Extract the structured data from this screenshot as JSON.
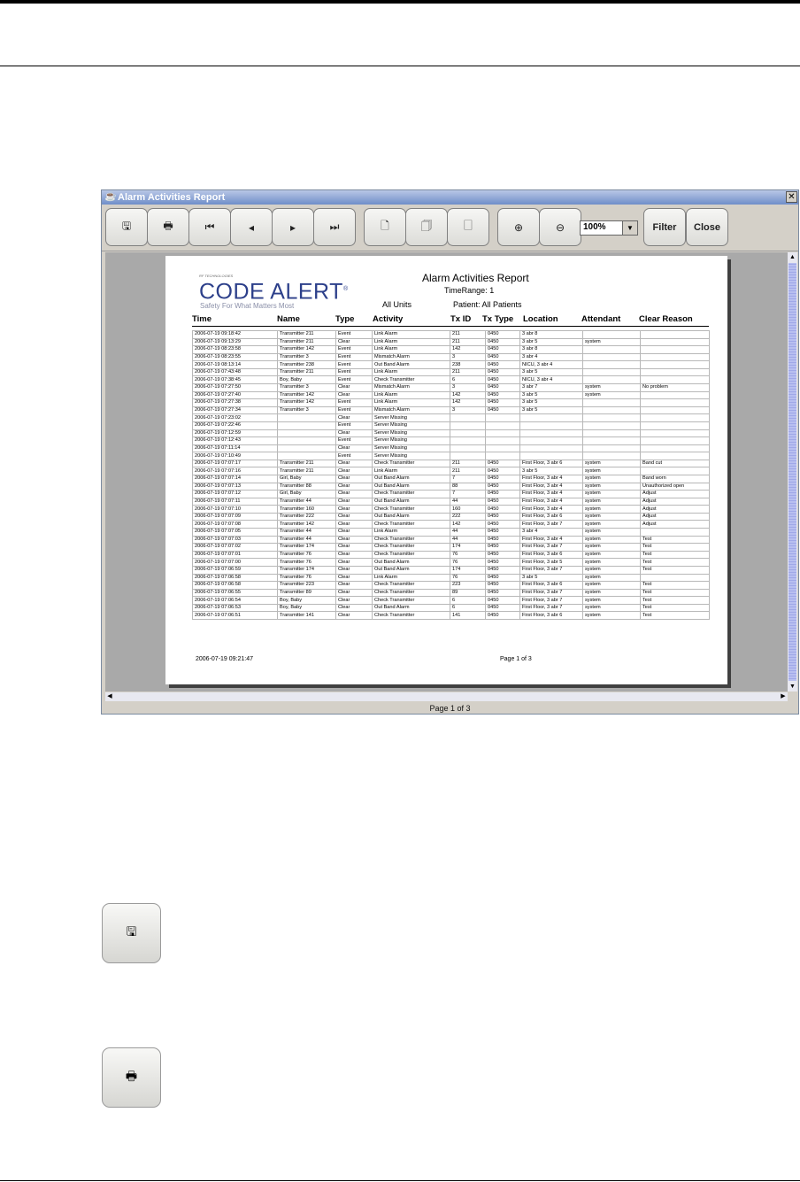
{
  "window": {
    "title": "Alarm Activities Report",
    "close_glyph": "✕"
  },
  "toolbar": {
    "buttons": [
      {
        "icon": "save-icon",
        "glyph": "🖫"
      },
      {
        "icon": "print-icon",
        "glyph": "🖶"
      },
      {
        "icon": "first-page-icon",
        "glyph": "⏮"
      },
      {
        "icon": "previous-page-icon",
        "glyph": "◂"
      },
      {
        "icon": "next-page-icon",
        "glyph": "▸"
      },
      {
        "icon": "last-page-icon",
        "glyph": "⏭"
      },
      {
        "icon": "page-icon",
        "glyph": "🗋"
      },
      {
        "icon": "page-width-icon",
        "glyph": "🗍"
      },
      {
        "icon": "whole-page-icon",
        "glyph": "🗌"
      },
      {
        "icon": "zoom-in-icon",
        "glyph": "⊕"
      },
      {
        "icon": "zoom-out-icon",
        "glyph": "⊖"
      }
    ],
    "zoom_value": "100%",
    "filter_label": "Filter",
    "close_label": "Close"
  },
  "report": {
    "logo_small": "RF TECHNOLOGIES",
    "logo": "CODE ALERT",
    "logo_mark": "®",
    "tagline": "Safety For What Matters Most",
    "title": "Alarm Activities Report",
    "time_range": "TimeRange: 1",
    "units": "All Units",
    "patient": "Patient: All Patients",
    "columns": [
      "Time",
      "Name",
      "Type",
      "Activity",
      "Tx ID",
      "Tx Type",
      "Location",
      "Attendant",
      "Clear Reason"
    ],
    "rows": [
      [
        "2006-07-19 09:18:42",
        "Transmitter 211",
        "Event",
        "Link Alarm",
        "211",
        "0450",
        "3 abr 8",
        "",
        ""
      ],
      [
        "2006-07-19 09:13:29",
        "Transmitter 211",
        "Clear",
        "Link Alarm",
        "211",
        "0450",
        "3 abr 5",
        "system",
        ""
      ],
      [
        "2006-07-19 08:23:58",
        "Transmitter 142",
        "Event",
        "Link Alarm",
        "142",
        "0450",
        "3 abr 8",
        "",
        ""
      ],
      [
        "2006-07-19 08:23:55",
        "Transmitter 3",
        "Event",
        "Mismatch Alarm",
        "3",
        "0450",
        "3 abr 4",
        "",
        ""
      ],
      [
        "2006-07-19 08:13:14",
        "Transmitter 238",
        "Event",
        "Out Band Alarm",
        "238",
        "0450",
        "NICU, 3 abr 4",
        "",
        ""
      ],
      [
        "2006-07-19 07:43:48",
        "Transmitter 211",
        "Event",
        "Link Alarm",
        "211",
        "0450",
        "3 abr 5",
        "",
        ""
      ],
      [
        "2006-07-19 07:38:45",
        "Boy, Baby",
        "Event",
        "Check Transmitter",
        "6",
        "0450",
        "NICU, 3 abr 4",
        "",
        ""
      ],
      [
        "2006-07-19 07:27:50",
        "Transmitter 3",
        "Clear",
        "Mismatch Alarm",
        "3",
        "0450",
        "3 abr 7",
        "system",
        "No problem"
      ],
      [
        "2006-07-19 07:27:40",
        "Transmitter 142",
        "Clear",
        "Link Alarm",
        "142",
        "0450",
        "3 abr 5",
        "system",
        ""
      ],
      [
        "2006-07-19 07:27:38",
        "Transmitter 142",
        "Event",
        "Link Alarm",
        "142",
        "0450",
        "3 abr 5",
        "",
        ""
      ],
      [
        "2006-07-19 07:27:34",
        "Transmitter 3",
        "Event",
        "Mismatch Alarm",
        "3",
        "0450",
        "3 abr 5",
        "",
        ""
      ],
      [
        "2006-07-19 07:23:02",
        "",
        "Clear",
        "Server Missing",
        "",
        "",
        "",
        "",
        ""
      ],
      [
        "2006-07-19 07:22:46",
        "",
        "Event",
        "Server Missing",
        "",
        "",
        "",
        "",
        ""
      ],
      [
        "2006-07-19 07:12:59",
        "",
        "Clear",
        "Server Missing",
        "",
        "",
        "",
        "",
        ""
      ],
      [
        "2006-07-19 07:12:43",
        "",
        "Event",
        "Server Missing",
        "",
        "",
        "",
        "",
        ""
      ],
      [
        "2006-07-19 07:11:14",
        "",
        "Clear",
        "Server Missing",
        "",
        "",
        "",
        "",
        ""
      ],
      [
        "2006-07-19 07:10:49",
        "",
        "Event",
        "Server Missing",
        "",
        "",
        "",
        "",
        ""
      ],
      [
        "2006-07-19 07:07:17",
        "Transmitter 211",
        "Clear",
        "Check Transmitter",
        "211",
        "0450",
        "First Floor, 3 abr 6",
        "system",
        "Band cut"
      ],
      [
        "2006-07-19 07:07:16",
        "Transmitter 211",
        "Clear",
        "Link Alarm",
        "211",
        "0450",
        "3 abr 5",
        "system",
        ""
      ],
      [
        "2006-07-19 07:07:14",
        "Girl, Baby",
        "Clear",
        "Out Band Alarm",
        "7",
        "0450",
        "First Floor, 3 abr 4",
        "system",
        "Band worn"
      ],
      [
        "2006-07-19 07:07:13",
        "Transmitter 88",
        "Clear",
        "Out Band Alarm",
        "88",
        "0450",
        "First Floor, 3 abr 4",
        "system",
        "Unauthorized open"
      ],
      [
        "2006-07-19 07:07:12",
        "Girl, Baby",
        "Clear",
        "Check Transmitter",
        "7",
        "0450",
        "First Floor, 3 abr 4",
        "system",
        "Adjust"
      ],
      [
        "2006-07-19 07:07:11",
        "Transmitter 44",
        "Clear",
        "Out Band Alarm",
        "44",
        "0450",
        "First Floor, 3 abr 4",
        "system",
        "Adjust"
      ],
      [
        "2006-07-19 07:07:10",
        "Transmitter 160",
        "Clear",
        "Check Transmitter",
        "160",
        "0450",
        "First Floor, 3 abr 4",
        "system",
        "Adjust"
      ],
      [
        "2006-07-19 07:07:09",
        "Transmitter 222",
        "Clear",
        "Out Band Alarm",
        "222",
        "0450",
        "First Floor, 3 abr 6",
        "system",
        "Adjust"
      ],
      [
        "2006-07-19 07:07:08",
        "Transmitter 142",
        "Clear",
        "Check Transmitter",
        "142",
        "0450",
        "First Floor, 3 abr 7",
        "system",
        "Adjust"
      ],
      [
        "2006-07-19 07:07:05",
        "Transmitter 44",
        "Clear",
        "Link Alarm",
        "44",
        "0450",
        "3 abr 4",
        "system",
        ""
      ],
      [
        "2006-07-19 07:07:03",
        "Transmitter 44",
        "Clear",
        "Check Transmitter",
        "44",
        "0450",
        "First Floor, 3 abr 4",
        "system",
        "Test"
      ],
      [
        "2006-07-19 07:07:02",
        "Transmitter 174",
        "Clear",
        "Check Transmitter",
        "174",
        "0450",
        "First Floor, 3 abr 7",
        "system",
        "Test"
      ],
      [
        "2006-07-19 07:07:01",
        "Transmitter 76",
        "Clear",
        "Check Transmitter",
        "76",
        "0450",
        "First Floor, 3 abr 6",
        "system",
        "Test"
      ],
      [
        "2006-07-19 07:07:00",
        "Transmitter 76",
        "Clear",
        "Out Band Alarm",
        "76",
        "0450",
        "First Floor, 3 abr 5",
        "system",
        "Test"
      ],
      [
        "2006-07-19 07:06:59",
        "Transmitter 174",
        "Clear",
        "Out Band Alarm",
        "174",
        "0450",
        "First Floor, 3 abr 7",
        "system",
        "Test"
      ],
      [
        "2006-07-19 07:06:58",
        "Transmitter 76",
        "Clear",
        "Link Alarm",
        "76",
        "0450",
        "3 abr 5",
        "system",
        ""
      ],
      [
        "2006-07-19 07:06:58",
        "Transmitter 223",
        "Clear",
        "Check Transmitter",
        "223",
        "0450",
        "First Floor, 3 abr 6",
        "system",
        "Test"
      ],
      [
        "2006-07-19 07:06:55",
        "Transmitter 89",
        "Clear",
        "Check Transmitter",
        "89",
        "0450",
        "First Floor, 3 abr 7",
        "system",
        "Test"
      ],
      [
        "2006-07-19 07:06:54",
        "Boy, Baby",
        "Clear",
        "Check Transmitter",
        "6",
        "0450",
        "First Floor, 3 abr 7",
        "system",
        "Test"
      ],
      [
        "2006-07-19 07:06:53",
        "Boy, Baby",
        "Clear",
        "Out Band Alarm",
        "6",
        "0450",
        "First Floor, 3 abr 7",
        "system",
        "Test"
      ],
      [
        "2006-07-19 07:06:51",
        "Transmitter 141",
        "Clear",
        "Check Transmitter",
        "141",
        "0450",
        "First Floor, 3 abr 6",
        "system",
        "Test"
      ]
    ],
    "footer_date": "2006-07-19 09:21:47",
    "footer_page": "Page 1 of 3"
  },
  "status_text": "Page 1 of 3",
  "big_buttons": [
    {
      "icon": "save-icon",
      "glyph": "🖫"
    },
    {
      "icon": "print-icon",
      "glyph": "🖶"
    }
  ],
  "colors": {
    "logo": "#2c3f8a",
    "titlebar": "#6f8ec9",
    "toolbar_bg": "#d4d0c8"
  }
}
